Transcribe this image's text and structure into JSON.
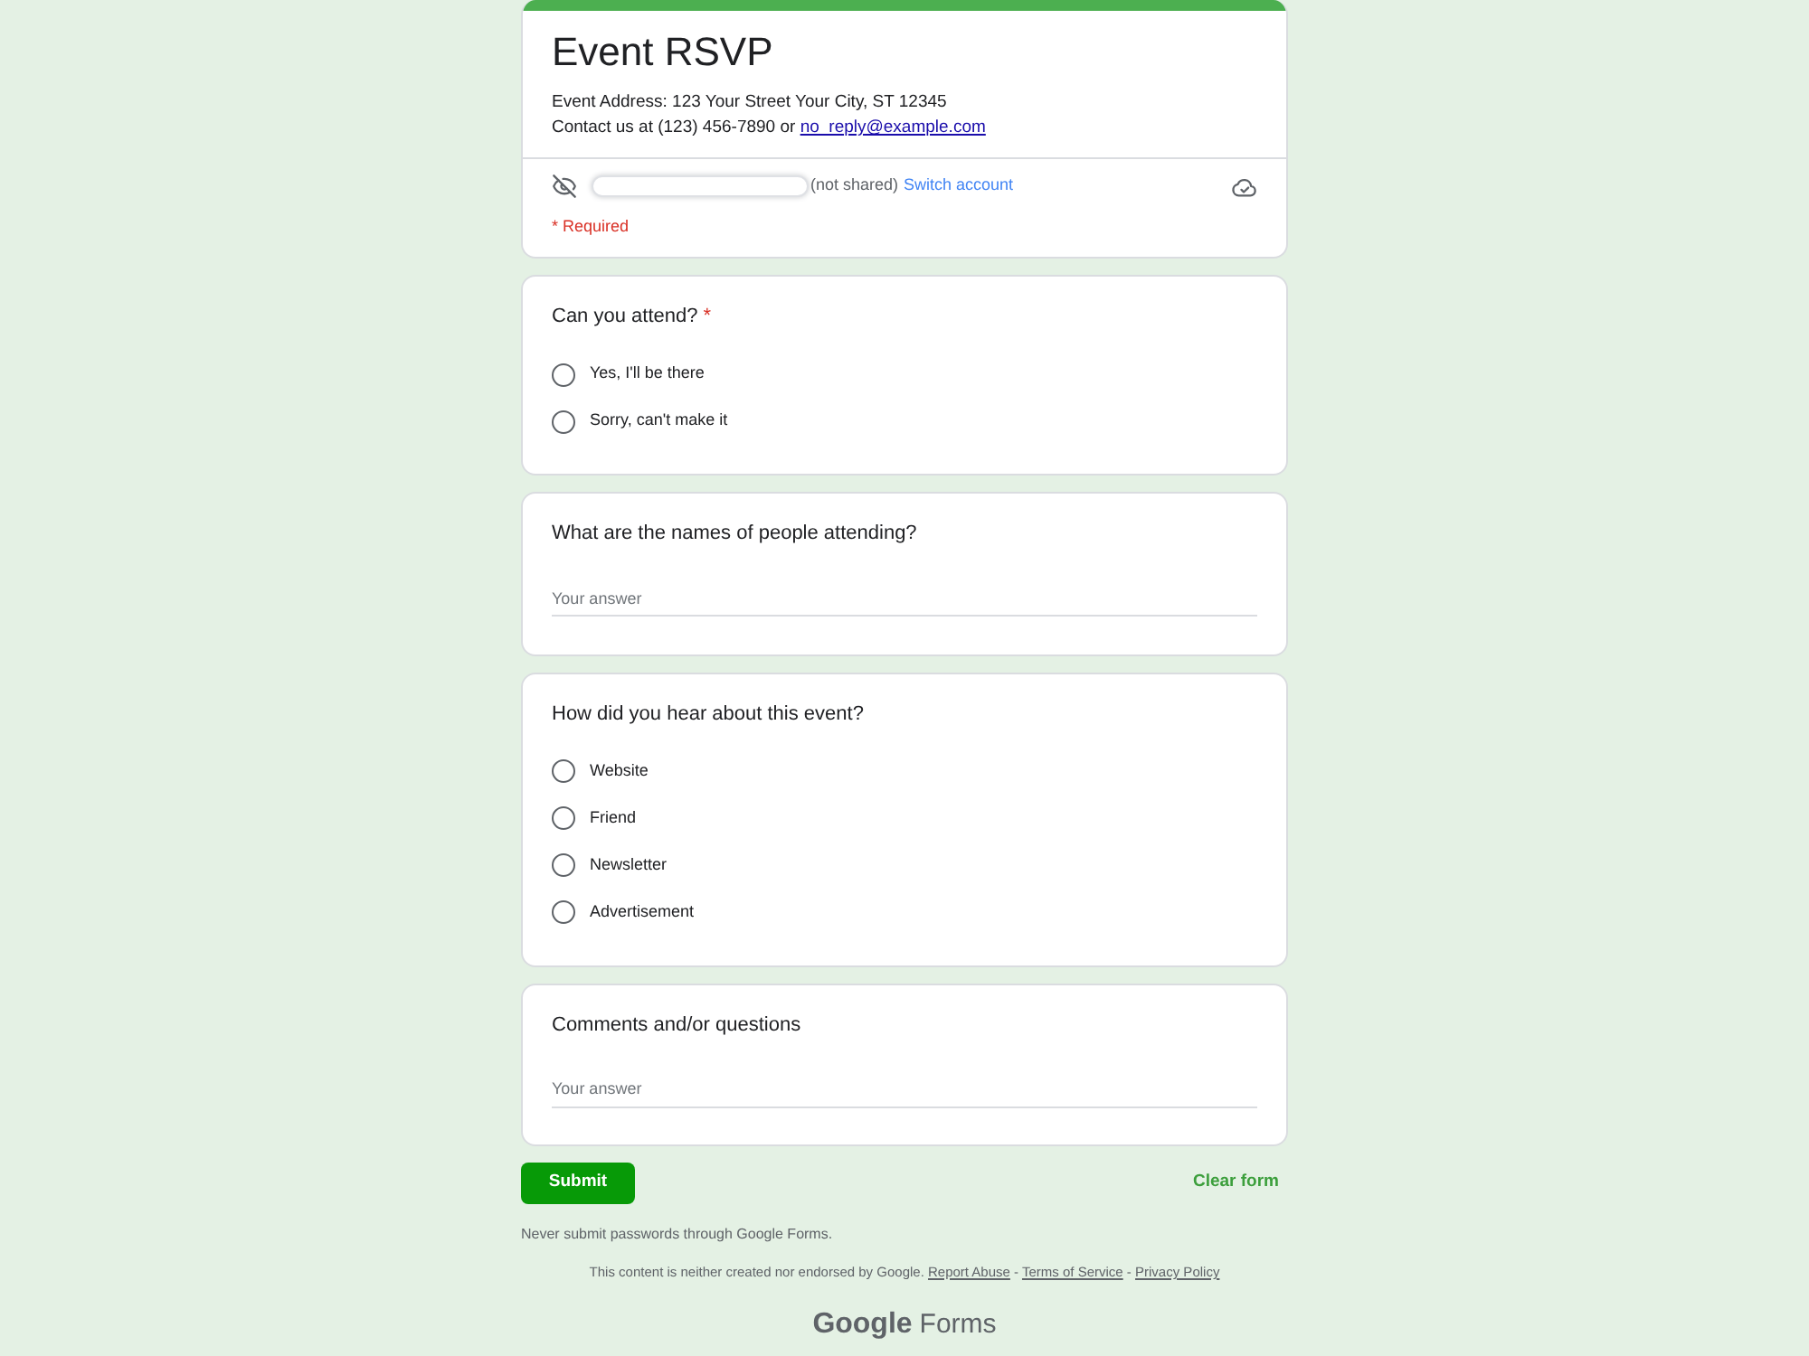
{
  "header": {
    "title": "Event RSVP",
    "description": [
      {
        "text": "Event Address: 123 Your Street Your City, ST 12345"
      },
      {
        "text": "Contact us at (123) 456-7890 or",
        "link": "no_reply@example.com"
      }
    ],
    "account": {
      "email_redacted": true,
      "status": "(not shared)",
      "switch_link": "Switch account"
    },
    "required_note": "* Required"
  },
  "required_mark": "*",
  "questions": [
    {
      "kind": "radio",
      "title": "Can you attend?",
      "required": true,
      "options": [
        {
          "label": "Yes, I'll be there",
          "selected": false
        },
        {
          "label": "Sorry, can't make it",
          "selected": false
        }
      ]
    },
    {
      "kind": "text",
      "title": "What are the names of people attending?",
      "required": false,
      "placeholder": "Your answer"
    },
    {
      "kind": "radio",
      "title": "How did you hear about this event?",
      "required": false,
      "options": [
        {
          "label": "Website",
          "selected": false
        },
        {
          "label": "Friend",
          "selected": false
        },
        {
          "label": "Newsletter",
          "selected": false
        },
        {
          "label": "Advertisement",
          "selected": false
        }
      ]
    },
    {
      "kind": "text",
      "title": "Comments and/or questions",
      "required": false,
      "placeholder": "Your answer"
    }
  ],
  "actions": {
    "submit": "Submit",
    "clear": "Clear form"
  },
  "footer": {
    "warning": "Never submit passwords through Google Forms.",
    "disclaimer": "This content is neither created nor endorsed by Google.",
    "separator": "-",
    "links": [
      "Report Abuse",
      "Terms of Service",
      "Privacy Policy"
    ],
    "logo": {
      "brand": "Google",
      "product": "Forms"
    }
  }
}
